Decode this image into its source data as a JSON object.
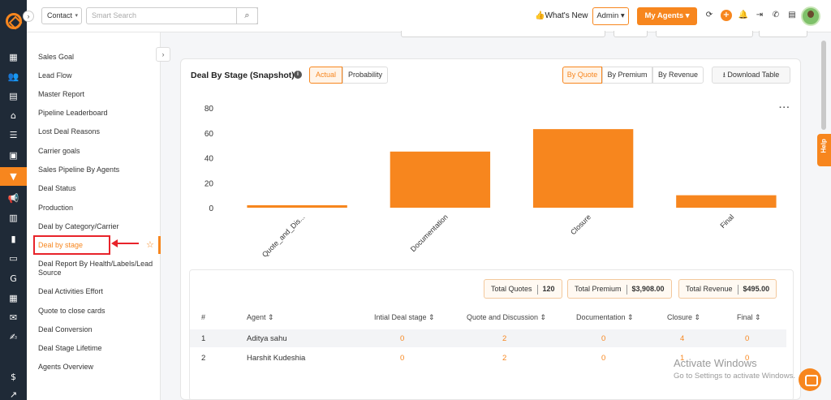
{
  "topbar": {
    "contact_select": "Contact",
    "search_placeholder": "Smart Search",
    "whats_new": "👍What's New",
    "admin": "Admin",
    "my_agents": "My Agents"
  },
  "sidebar": {
    "items": [
      "Sales Goal",
      "Lead Flow",
      "Master Report",
      "Pipeline Leaderboard",
      "Lost Deal Reasons",
      "Carrier goals",
      "Sales Pipeline By Agents",
      "Deal Status",
      "Production",
      "Deal by Category/Carrier",
      "Deal by stage",
      "Deal Report By Health/Labels/Lead Source",
      "Deal Activities Effort",
      "Quote to close cards",
      "Deal Conversion",
      "Deal Stage Lifetime",
      "Agents Overview"
    ],
    "active_index": 10
  },
  "card": {
    "title": "Deal By Stage (Snapshot)",
    "toggle_actual": "Actual",
    "toggle_probability": "Probability",
    "by_quote": "By Quote",
    "by_premium": "By Premium",
    "by_revenue": "By Revenue",
    "download": "⭳ Download Table"
  },
  "chart_data": {
    "type": "bar",
    "categories": [
      "Quote_and_Dis...",
      "Documentation",
      "Closure",
      "Final"
    ],
    "values": [
      2,
      45,
      63,
      10
    ],
    "ylim": [
      0,
      80
    ],
    "yticks": [
      0,
      20,
      40,
      60,
      80
    ],
    "color": "#f7861e",
    "grid": false
  },
  "totals": {
    "quotes_label": "Total Quotes",
    "quotes_value": "120",
    "premium_label": "Total Premium",
    "premium_value": "$3,908.00",
    "revenue_label": "Total Revenue",
    "revenue_value": "$495.00"
  },
  "table": {
    "headers": [
      "#",
      "Agent ⇕",
      "Intial Deal stage ⇕",
      "Quote and Discussion ⇕",
      "Documentation ⇕",
      "Closure ⇕",
      "Final ⇕"
    ],
    "rows": [
      [
        "1",
        "Aditya sahu",
        "0",
        "2",
        "0",
        "4",
        "0"
      ],
      [
        "2",
        "Harshit Kudeshia",
        "0",
        "2",
        "0",
        "1",
        "0"
      ]
    ]
  },
  "overlays": {
    "help": "Help",
    "watermark_title": "Activate Windows",
    "watermark_sub": "Go to Settings to activate Windows."
  }
}
